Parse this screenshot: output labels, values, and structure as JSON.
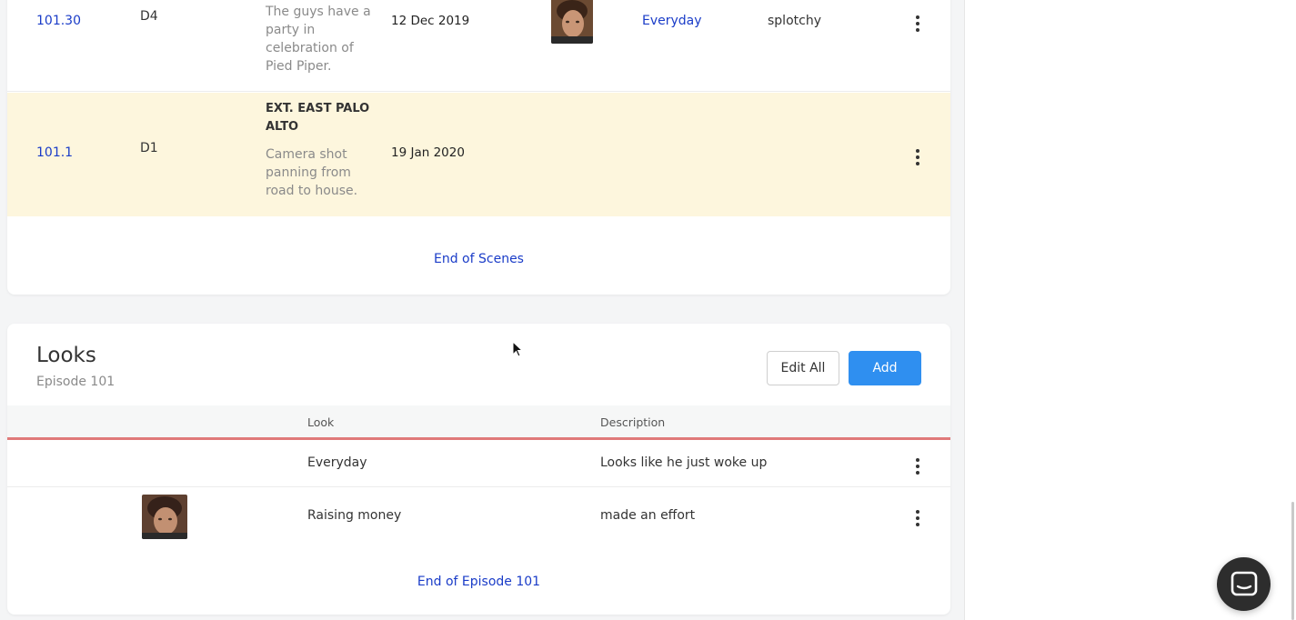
{
  "scenes": {
    "rows": [
      {
        "number": "101.30",
        "day": "D4",
        "heading": "",
        "description": "The guys have a party in celebration of Pied Piper.",
        "date": "12 Dec 2019",
        "look": "Everyday",
        "note": "splotchy"
      },
      {
        "number": "101.1",
        "day": "D1",
        "heading": "EXT. EAST PALO ALTO",
        "description": "Camera shot panning from road to house.",
        "date": "19 Jan 2020",
        "look": "",
        "note": ""
      }
    ],
    "end_label": "End of Scenes"
  },
  "looks": {
    "title": "Looks",
    "subtitle": "Episode 101",
    "edit_all_label": "Edit All",
    "add_label": "Add",
    "columns": {
      "look": "Look",
      "description": "Description"
    },
    "rows": [
      {
        "look": "Everyday",
        "description": "Looks like he just woke up"
      },
      {
        "look": "Raising money",
        "description": "made an effort"
      }
    ],
    "end_label": "End of Episode 101"
  },
  "colors": {
    "link": "#1a3cc8",
    "highlight_row": "#fdf6dd",
    "primary_button": "#2f8ff0",
    "header_underline": "#e07a7a"
  },
  "icons": [
    "kebab-menu-icon",
    "chat-bubble-icon",
    "mouse-cursor-icon"
  ]
}
